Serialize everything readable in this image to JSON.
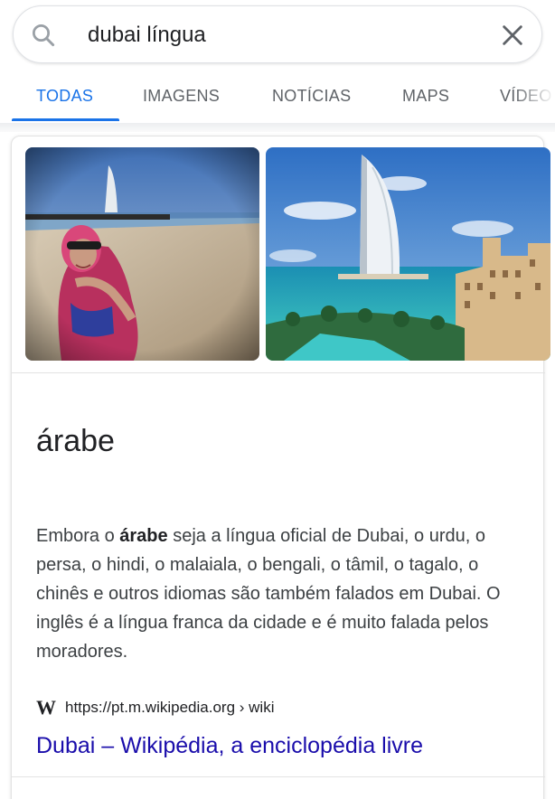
{
  "search": {
    "query": "dubai língua",
    "search_icon": "search-icon",
    "clear_icon": "close-icon"
  },
  "tabs": [
    {
      "label": "TODAS",
      "active": true
    },
    {
      "label": "IMAGENS",
      "active": false
    },
    {
      "label": "NOTÍCIAS",
      "active": false
    },
    {
      "label": "MAPS",
      "active": false
    },
    {
      "label": "VÍDEO",
      "active": false
    }
  ],
  "knowledge_card": {
    "images": [
      {
        "depicts": "woman in pink headscarf on beach with Burj Al Arab behind"
      },
      {
        "depicts": "Burj Al Arab hotel with turquoise sea and resort"
      }
    ],
    "answer": "árabe",
    "description_pre": "Embora o ",
    "description_bold": "árabe",
    "description_post": " seja a língua oficial de Dubai, o urdu, o persa, o hindi, o malaiala, o bengali, o tâmil, o tagalo, o chinês e outros idiomas são também falados em Dubai. O inglês é a língua franca da cidade e é muito falada pelos moradores.",
    "source_icon": "wikipedia-icon",
    "source_icon_glyph": "W",
    "source_url": "https://pt.m.wikipedia.org › wiki",
    "link_title": "Dubai – Wikipédia, a enciclopédia livre"
  },
  "colors": {
    "accent": "#1a73e8",
    "link": "#1a0dab",
    "tab_inactive": "#5f6368",
    "text": "#202124"
  }
}
